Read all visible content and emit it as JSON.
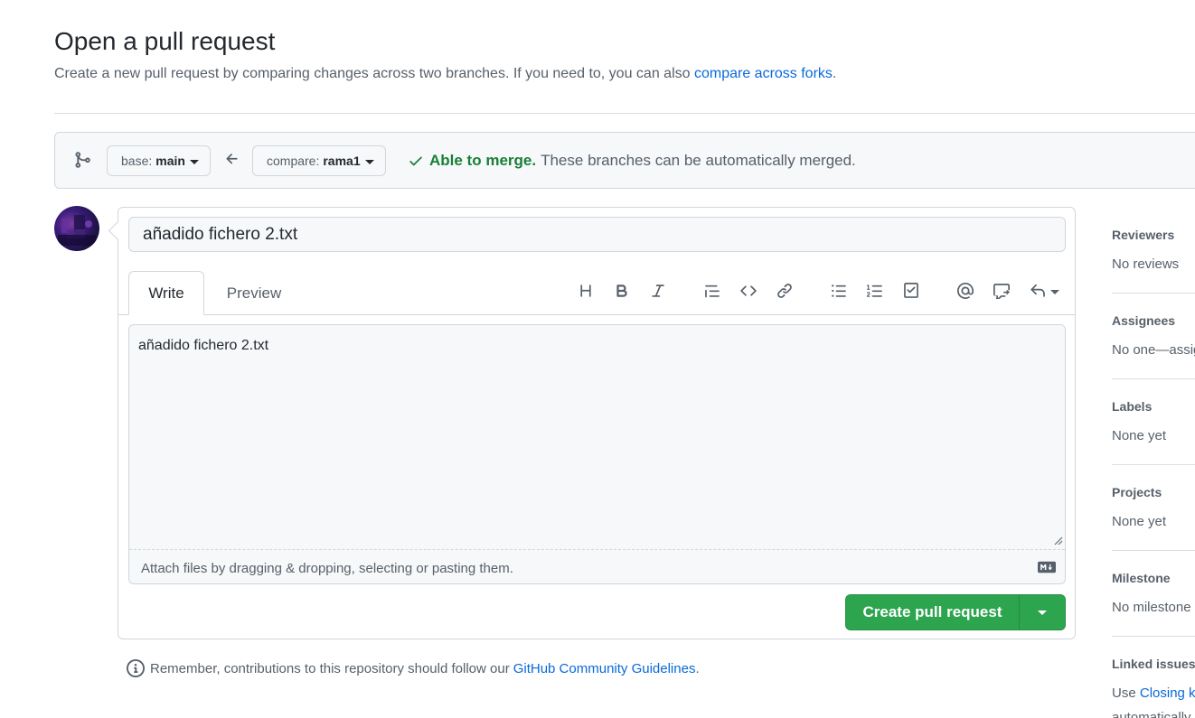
{
  "header": {
    "title": "Open a pull request",
    "subtitle": "Create a new pull request by comparing changes across two branches. If you need to, you can also",
    "compare_forks_link": "compare across forks",
    "subtitle_end": "."
  },
  "range": {
    "base_label": "base:",
    "base_branch": "main",
    "compare_label": "compare:",
    "compare_branch": "rama1",
    "merge_status": "Able to merge.",
    "merge_message": "These branches can be automatically merged."
  },
  "form": {
    "title_value": "añadido fichero 2.txt",
    "tabs": [
      {
        "label": "Write",
        "active": true
      },
      {
        "label": "Preview",
        "active": false
      }
    ],
    "toolbar_icons": [
      "heading-icon",
      "bold-icon",
      "italic-icon",
      "quote-icon",
      "code-icon",
      "link-icon",
      "unordered-list-icon",
      "ordered-list-icon",
      "task-list-icon",
      "mention-icon",
      "reference-icon",
      "saved-replies-icon"
    ],
    "body_value": "añadido fichero 2.txt",
    "attach_hint": "Attach files by dragging & dropping, selecting or pasting them.",
    "submit_label": "Create pull request"
  },
  "footer": {
    "guidelines_text": "Remember, contributions to this repository should follow our",
    "guidelines_link": "GitHub Community Guidelines",
    "guidelines_end": "."
  },
  "sidebar": {
    "sections": [
      {
        "title": "Reviewers",
        "value": "No reviews"
      },
      {
        "title": "Assignees",
        "value": "No one—assign yourself"
      },
      {
        "title": "Labels",
        "value": "None yet"
      },
      {
        "title": "Projects",
        "value": "None yet"
      },
      {
        "title": "Milestone",
        "value": "No milestone"
      },
      {
        "title": "Linked issues",
        "value_prefix": "Use",
        "value_link": "Closing keywords",
        "value_line2": "automatically"
      }
    ]
  },
  "colors": {
    "accent_green": "#2da44e",
    "link_blue": "#0969da",
    "success_text": "#1a7f37"
  }
}
